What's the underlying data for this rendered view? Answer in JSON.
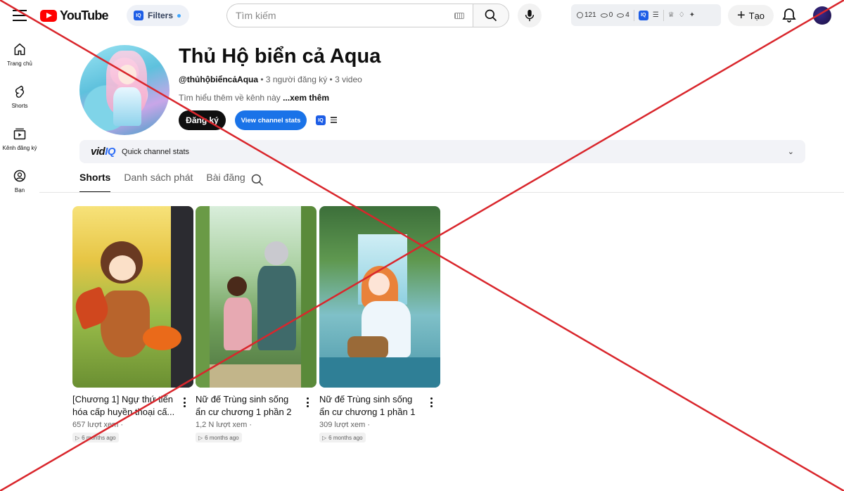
{
  "header": {
    "logo_text": "YouTube",
    "filters_label": "Filters",
    "search_placeholder": "Tìm kiếm",
    "ext_stats": {
      "history": "121",
      "views_a": "0",
      "views_b": "4"
    },
    "create_label": "Tạo"
  },
  "sidebar": {
    "items": [
      {
        "label": "Trang chủ",
        "icon": "home-icon"
      },
      {
        "label": "Shorts",
        "icon": "shorts-icon"
      },
      {
        "label": "Kênh đăng ký",
        "icon": "subscriptions-icon"
      },
      {
        "label": "Bạn",
        "icon": "user-icon"
      }
    ]
  },
  "channel": {
    "title": "Thủ Hộ biển cả Aqua",
    "handle": "@thủhộbiểncảAqua",
    "subscribers": "3 người đăng ký",
    "videos": "3 video",
    "meta_sep": " • ",
    "description": "Tìm hiểu thêm về kênh này ",
    "more_label": "...xem thêm",
    "subscribe_label": "Đăng ký",
    "stats_button_label": "View channel stats",
    "iq_badge": "IQ"
  },
  "vidiq": {
    "logo_main": "vid",
    "logo_iq": "IQ",
    "label": "Quick channel stats"
  },
  "tabs": [
    {
      "label": "Shorts",
      "active": true
    },
    {
      "label": "Danh sách phát",
      "active": false
    },
    {
      "label": "Bài đăng",
      "active": false
    }
  ],
  "shorts": [
    {
      "title": "[Chương 1] Ngự thứ tiến hóa cấp huyền thoại cấ...",
      "views": "657 lượt xem ·",
      "age": "6 months ago"
    },
    {
      "title": "Nữ đế Trùng sinh sống ẩn cư chương 1 phần 2",
      "views": "1,2 N lượt xem ·",
      "age": "6 months ago"
    },
    {
      "title": "Nữ đế Trùng sinh sống ẩn cư chương 1 phần 1",
      "views": "309 lượt xem ·",
      "age": "6 months ago"
    }
  ],
  "colors": {
    "brand_red": "#ff0000",
    "stats_blue": "#1a73e8",
    "overlay_x": "#d9262c"
  }
}
